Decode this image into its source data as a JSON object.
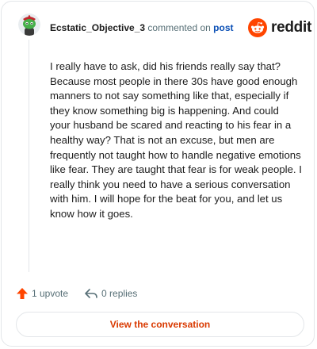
{
  "comment": {
    "username": "Ecstatic_Objective_3",
    "commented_on": "commented on",
    "post_link": "post",
    "body": "I really have to ask, did his friends really say that? Because most people in there 30s have good enough manners to not say something like that, especially if they know something big is happening. And could your husband be scared and reacting to his fear in a healthy way? That is not an excuse, but men are frequently not taught how to handle negative emotions like fear. They are taught that fear is for weak people. I really think you need to have a serious conversation with him. I will hope for the beat for you, and let us know how it goes."
  },
  "brand": {
    "name": "reddit",
    "color": "#ff4500"
  },
  "actions": {
    "upvote_label": "1 upvote",
    "replies_label": "0 replies"
  },
  "footer": {
    "view_label": "View the conversation"
  },
  "icons": {
    "avatar": "snoo-avatar-icon",
    "logo": "reddit-logo-icon",
    "upvote": "upvote-arrow-icon",
    "reply": "reply-arrow-icon"
  }
}
